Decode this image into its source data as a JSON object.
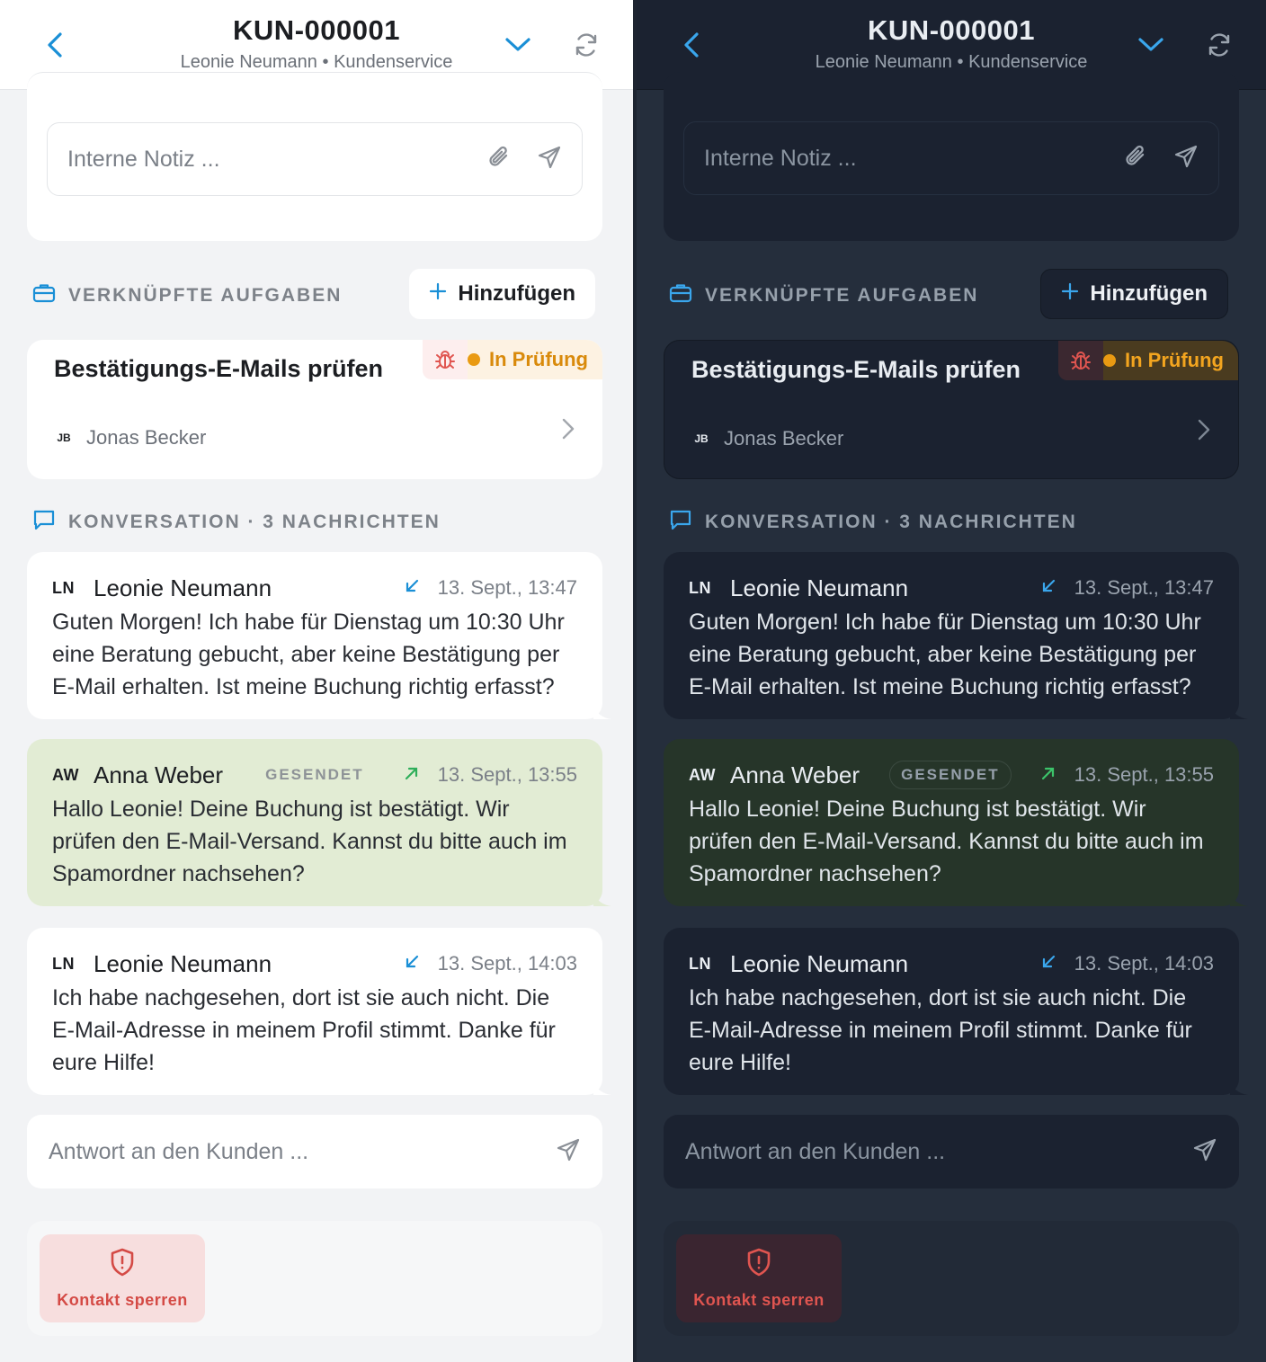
{
  "header": {
    "title": "KUN-000001",
    "customer": "Leonie Neumann",
    "separator": "•",
    "department": "Kundenservice"
  },
  "note": {
    "placeholder": "Interne Notiz ..."
  },
  "tasks_section": {
    "heading": "VERKNÜPFTE AUFGABEN",
    "add_label": "Hinzufügen",
    "task": {
      "title": "Bestätigungs-E-Mails prüfen",
      "status": "In Prüfung",
      "assignee_initials": "JB",
      "assignee": "Jonas Becker"
    }
  },
  "conversation": {
    "heading": "KONVERSATION · 3 NACHRICHTEN",
    "messages": [
      {
        "initials": "LN",
        "sender": "Leonie Neumann",
        "time": "13. Sept., 13:47",
        "body": "Guten Morgen! Ich habe für Dienstag um 10:30 Uhr eine Beratung gebucht, aber keine Bestätigung per E-Mail erhalten. Ist meine Buchung richtig erfasst?"
      },
      {
        "initials": "AW",
        "sender": "Anna Weber",
        "badge": "GESENDET",
        "time": "13. Sept., 13:55",
        "body": "Hallo Leonie! Deine Buchung ist bestätigt. Wir prüfen den E-Mail-Versand. Kannst du bitte auch im Spamordner nachsehen?"
      },
      {
        "initials": "LN",
        "sender": "Leonie Neumann",
        "time": "13. Sept., 14:03",
        "body": "Ich habe nachgesehen, dort ist sie auch nicht. Die E-Mail-Adresse in meinem Profil stimmt. Danke für eure Hilfe!"
      }
    ]
  },
  "reply": {
    "placeholder": "Antwort an den Kunden ..."
  },
  "actions": {
    "block_label": "Kontakt sperren"
  },
  "colors": {
    "accent": "#1a8fd6",
    "status_amber": "#e99a12",
    "danger": "#d44a45",
    "agent_bubble_light": "#e2ecd4",
    "agent_bubble_dark": "#263529"
  }
}
